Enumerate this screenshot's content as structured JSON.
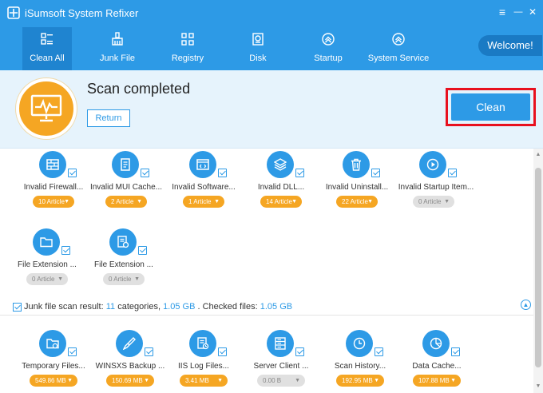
{
  "app": {
    "title": "iSumsoft System Refixer"
  },
  "window": {
    "menu_glyph": "≡",
    "minimize_glyph": "—",
    "close_glyph": "✕"
  },
  "nav": {
    "items": [
      {
        "label": "Clean All",
        "icon": "clean-all-icon"
      },
      {
        "label": "Junk File",
        "icon": "broom-icon"
      },
      {
        "label": "Registry",
        "icon": "registry-icon"
      },
      {
        "label": "Disk",
        "icon": "disk-icon"
      },
      {
        "label": "Startup",
        "icon": "startup-icon"
      },
      {
        "label": "System Service",
        "icon": "service-icon"
      }
    ],
    "welcome": "Welcome!"
  },
  "banner": {
    "title": "Scan completed",
    "return_label": "Return",
    "clean_label": "Clean"
  },
  "registry_items": [
    {
      "name": "Invalid Firewall...",
      "count": "10 Article",
      "active": true,
      "icon": "firewall-icon"
    },
    {
      "name": "Invalid MUI Cache...",
      "count": "2 Article",
      "active": true,
      "icon": "cache-icon"
    },
    {
      "name": "Invalid Software...",
      "count": "1 Article",
      "active": true,
      "icon": "software-icon"
    },
    {
      "name": "Invalid DLL...",
      "count": "14 Article",
      "active": true,
      "icon": "dll-icon"
    },
    {
      "name": "Invalid Uninstall...",
      "count": "22 Article",
      "active": true,
      "icon": "trash-icon"
    },
    {
      "name": "Invalid Startup Item...",
      "count": "0 Article",
      "active": false,
      "icon": "play-icon"
    },
    {
      "name": "File Extension ...",
      "count": "0 Article",
      "active": false,
      "icon": "folder-icon"
    },
    {
      "name": "File Extension ...",
      "count": "0 Article",
      "active": false,
      "icon": "file-ext-icon"
    }
  ],
  "junk_summary": {
    "prefix": "Junk file scan result: ",
    "categories": "11",
    "mid": " categories, ",
    "size": "1.05 GB",
    "checked_prefix": " . Checked files: ",
    "checked_size": "1.05 GB"
  },
  "junk_items": [
    {
      "name": "Temporary Files...",
      "size": "549.86 MB",
      "active": true,
      "icon": "temp-folder-icon"
    },
    {
      "name": "WINSXS Backup ...",
      "size": "150.69 MB",
      "active": true,
      "icon": "brush-icon"
    },
    {
      "name": "IIS Log Files...",
      "size": "3.41 MB",
      "active": true,
      "icon": "log-file-icon"
    },
    {
      "name": "Server Client ...",
      "size": "0.00 B",
      "active": false,
      "icon": "server-icon"
    },
    {
      "name": "Scan History...",
      "size": "192.95 MB",
      "active": true,
      "icon": "clock-icon"
    },
    {
      "name": "Data Cache...",
      "size": "107.88 MB",
      "active": true,
      "icon": "pie-icon"
    }
  ]
}
